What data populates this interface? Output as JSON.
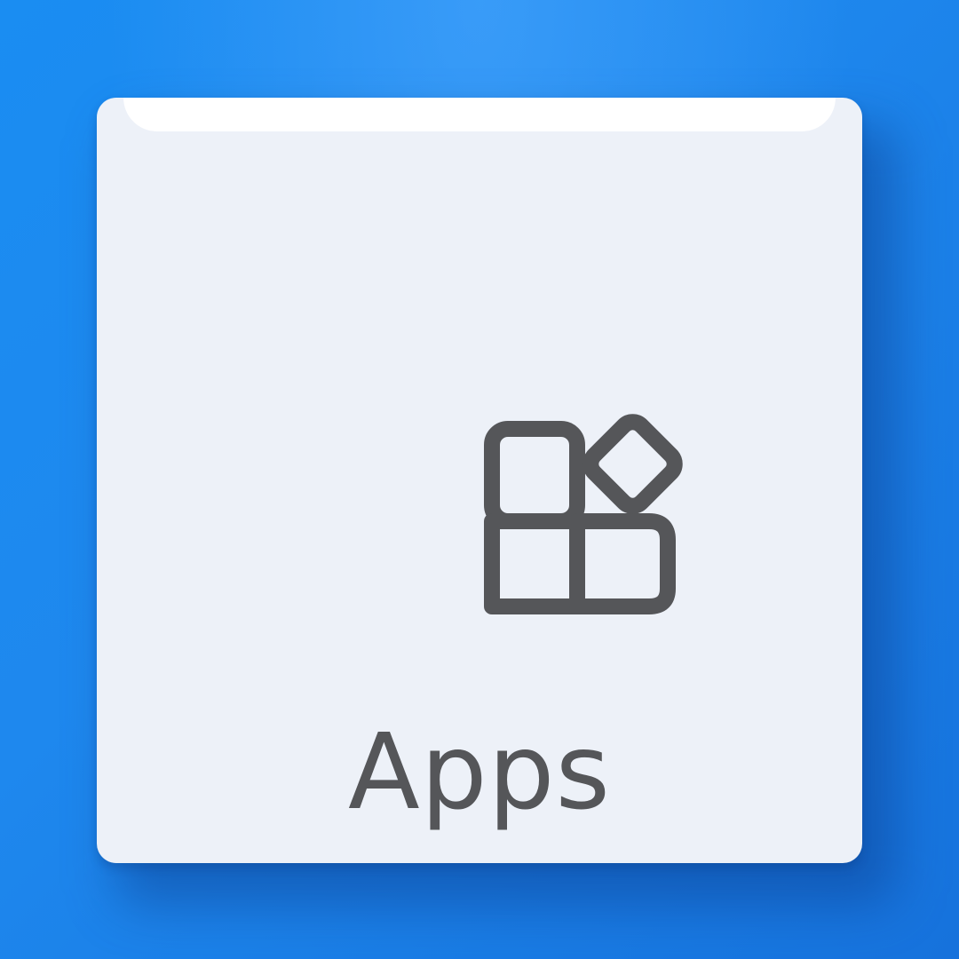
{
  "tile": {
    "label": "Apps",
    "icon": "apps-icon"
  },
  "colors": {
    "background": "#1e88ee",
    "tile": "#edf1f8",
    "foreground": "#555659"
  }
}
